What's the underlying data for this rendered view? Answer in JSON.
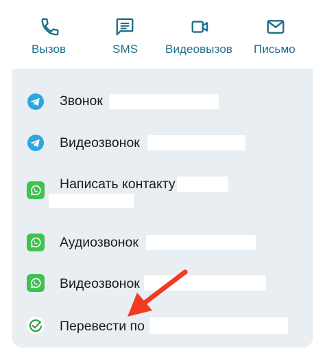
{
  "colors": {
    "accent": "#1f6e8a",
    "card_bg": "#e8eef1",
    "telegram": "#2ea6de",
    "whatsapp": "#3fc24f",
    "annotation_arrow": "#f03a22"
  },
  "actions": [
    {
      "label": "Вызов",
      "icon": "phone-icon"
    },
    {
      "label": "SMS",
      "icon": "message-icon"
    },
    {
      "label": "Видеовызов",
      "icon": "video-camera-icon"
    },
    {
      "label": "Письмо",
      "icon": "mail-icon"
    }
  ],
  "options": [
    {
      "text": "Звонок",
      "app": "telegram"
    },
    {
      "text": "Видеозвонок",
      "app": "telegram"
    },
    {
      "text": "Написать контакту",
      "app": "whatsapp"
    },
    {
      "text": "Аудиозвонок",
      "app": "whatsapp"
    },
    {
      "text": "Видеозвонок",
      "app": "whatsapp"
    },
    {
      "text": "Перевести по",
      "app": "payment"
    }
  ]
}
